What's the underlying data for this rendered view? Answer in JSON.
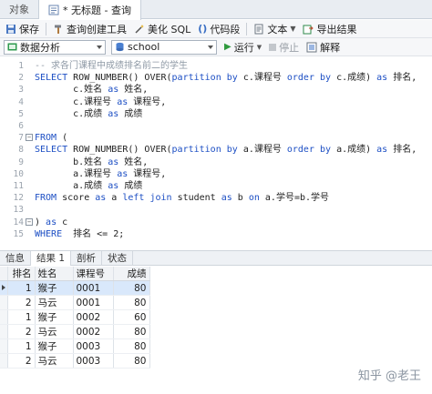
{
  "tabs": [
    {
      "label": "对象"
    },
    {
      "label": "* 无标题 - 查询"
    }
  ],
  "toolbar": {
    "save": "保存",
    "query_builder": "查询创建工具",
    "beautify": "美化 SQL",
    "snippet": "代码段",
    "text": "文本",
    "export": "导出结果"
  },
  "selectors": {
    "connection": "数据分析",
    "database": "school",
    "run": "运行",
    "stop": "停止",
    "explain": "解释"
  },
  "editor": {
    "lines": [
      {
        "n": "1",
        "segs": [
          {
            "t": "-- 求各门课程中成绩排名前二的学生",
            "c": "cm"
          }
        ]
      },
      {
        "n": "2",
        "segs": [
          {
            "t": "SELECT ",
            "c": "kw"
          },
          {
            "t": "ROW_NUMBER() OVER(",
            "c": "tx"
          },
          {
            "t": "partition by ",
            "c": "kw"
          },
          {
            "t": "c.课程号 ",
            "c": "tx"
          },
          {
            "t": "order by ",
            "c": "kw"
          },
          {
            "t": "c.成绩) ",
            "c": "tx"
          },
          {
            "t": "as ",
            "c": "kw"
          },
          {
            "t": "排名,",
            "c": "tx"
          }
        ]
      },
      {
        "n": "3",
        "segs": [
          {
            "t": "       c.姓名 ",
            "c": "tx"
          },
          {
            "t": "as ",
            "c": "kw"
          },
          {
            "t": "姓名,",
            "c": "tx"
          }
        ]
      },
      {
        "n": "4",
        "segs": [
          {
            "t": "       c.课程号 ",
            "c": "tx"
          },
          {
            "t": "as ",
            "c": "kw"
          },
          {
            "t": "课程号,",
            "c": "tx"
          }
        ]
      },
      {
        "n": "5",
        "segs": [
          {
            "t": "       c.成绩 ",
            "c": "tx"
          },
          {
            "t": "as ",
            "c": "kw"
          },
          {
            "t": "成绩",
            "c": "tx"
          }
        ]
      },
      {
        "n": "6",
        "segs": []
      },
      {
        "n": "7",
        "segs": [
          {
            "t": "FROM ",
            "c": "kw"
          },
          {
            "t": "(",
            "c": "tx"
          }
        ]
      },
      {
        "n": "8",
        "segs": [
          {
            "t": "SELECT ",
            "c": "kw"
          },
          {
            "t": "ROW_NUMBER() OVER(",
            "c": "tx"
          },
          {
            "t": "partition by ",
            "c": "kw"
          },
          {
            "t": "a.课程号 ",
            "c": "tx"
          },
          {
            "t": "order by ",
            "c": "kw"
          },
          {
            "t": "a.成绩) ",
            "c": "tx"
          },
          {
            "t": "as ",
            "c": "kw"
          },
          {
            "t": "排名,",
            "c": "tx"
          }
        ]
      },
      {
        "n": "9",
        "segs": [
          {
            "t": "       b.姓名 ",
            "c": "tx"
          },
          {
            "t": "as ",
            "c": "kw"
          },
          {
            "t": "姓名,",
            "c": "tx"
          }
        ]
      },
      {
        "n": "10",
        "segs": [
          {
            "t": "       a.课程号 ",
            "c": "tx"
          },
          {
            "t": "as ",
            "c": "kw"
          },
          {
            "t": "课程号,",
            "c": "tx"
          }
        ]
      },
      {
        "n": "11",
        "segs": [
          {
            "t": "       a.成绩 ",
            "c": "tx"
          },
          {
            "t": "as ",
            "c": "kw"
          },
          {
            "t": "成绩",
            "c": "tx"
          }
        ]
      },
      {
        "n": "12",
        "segs": [
          {
            "t": "FROM ",
            "c": "kw"
          },
          {
            "t": "score ",
            "c": "tx"
          },
          {
            "t": "as ",
            "c": "kw"
          },
          {
            "t": "a ",
            "c": "tx"
          },
          {
            "t": "left join ",
            "c": "kw"
          },
          {
            "t": "student ",
            "c": "tx"
          },
          {
            "t": "as ",
            "c": "kw"
          },
          {
            "t": "b ",
            "c": "tx"
          },
          {
            "t": "on ",
            "c": "kw"
          },
          {
            "t": "a.学号=b.学号",
            "c": "tx"
          }
        ]
      },
      {
        "n": "13",
        "segs": []
      },
      {
        "n": "14",
        "segs": [
          {
            "t": ") ",
            "c": "tx"
          },
          {
            "t": "as ",
            "c": "kw"
          },
          {
            "t": "c",
            "c": "tx"
          }
        ]
      },
      {
        "n": "15",
        "segs": [
          {
            "t": "WHERE ",
            "c": "kw"
          },
          {
            "t": " 排名 <= 2;",
            "c": "tx"
          }
        ]
      }
    ]
  },
  "result_tabs": [
    {
      "label": "信息"
    },
    {
      "label": "结果 1"
    },
    {
      "label": "剖析"
    },
    {
      "label": "状态"
    }
  ],
  "grid": {
    "headers": [
      "排名",
      "姓名",
      "课程号",
      "成绩"
    ],
    "rows": [
      [
        "1",
        "猴子",
        "0001",
        "80"
      ],
      [
        "2",
        "马云",
        "0001",
        "80"
      ],
      [
        "1",
        "猴子",
        "0002",
        "60"
      ],
      [
        "2",
        "马云",
        "0002",
        "80"
      ],
      [
        "1",
        "猴子",
        "0003",
        "80"
      ],
      [
        "2",
        "马云",
        "0003",
        "80"
      ]
    ]
  },
  "watermark": "知乎 @老王",
  "colors": {
    "keyword": "#1d4fc4",
    "comment": "#8f9aa6",
    "selected_row": "#d9e8fb"
  }
}
